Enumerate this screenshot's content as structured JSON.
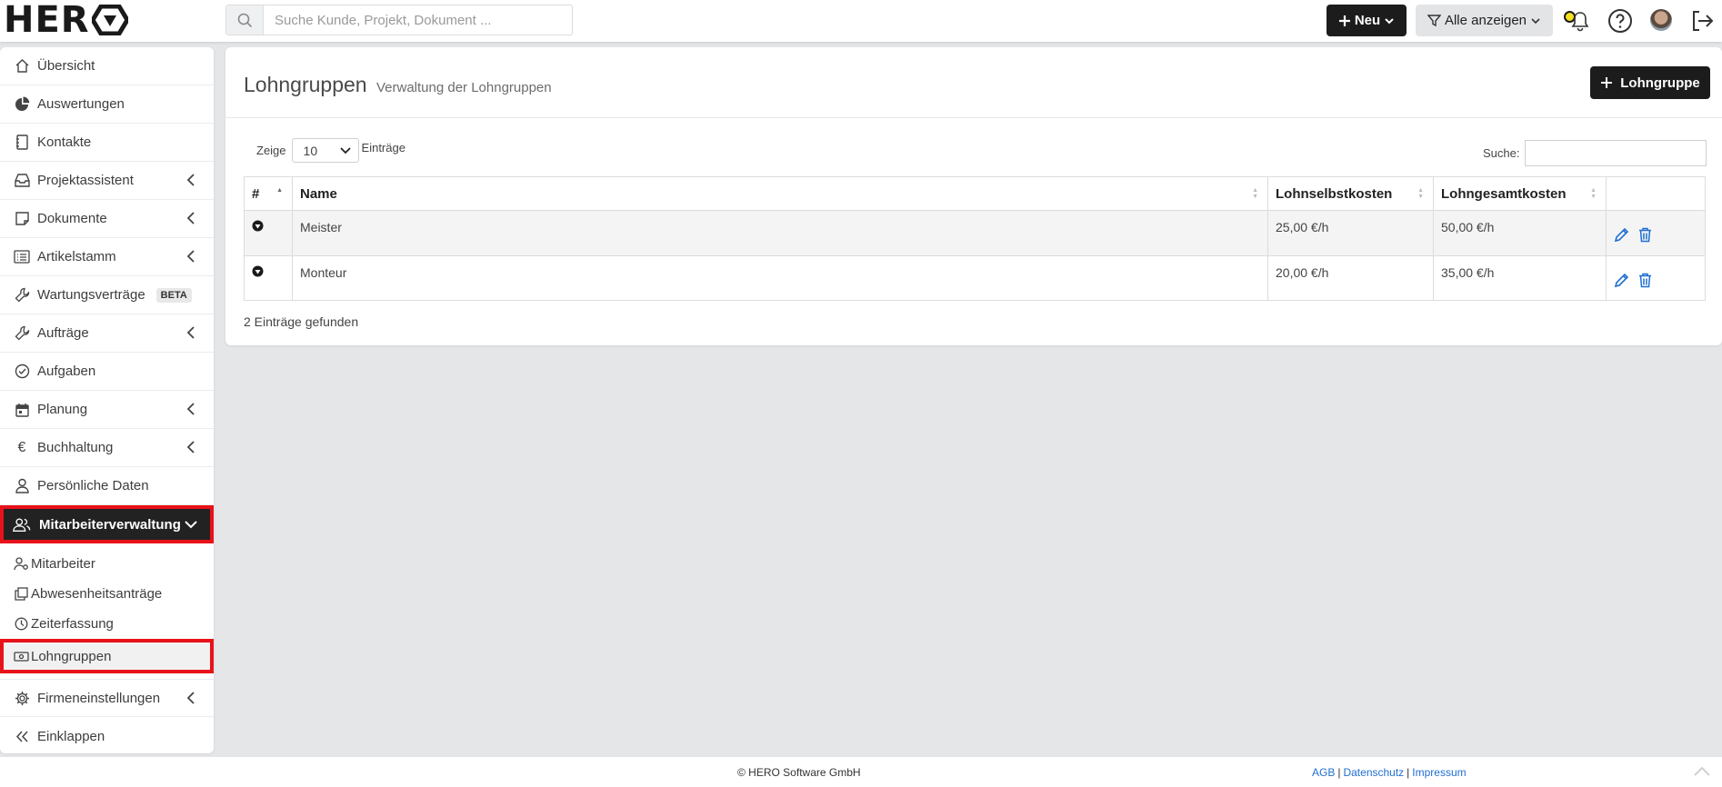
{
  "brand": {
    "logo_text": "HER"
  },
  "search": {
    "placeholder": "Suche Kunde, Projekt, Dokument ..."
  },
  "header": {
    "new_label": "Neu",
    "filter_label": "Alle anzeigen"
  },
  "sidebar": {
    "items": [
      {
        "label": "Übersicht"
      },
      {
        "label": "Auswertungen"
      },
      {
        "label": "Kontakte"
      },
      {
        "label": "Projektassistent"
      },
      {
        "label": "Dokumente"
      },
      {
        "label": "Artikelstamm"
      },
      {
        "label": "Wartungsverträge",
        "badge": "BETA"
      },
      {
        "label": "Aufträge"
      },
      {
        "label": "Aufgaben"
      },
      {
        "label": "Planung"
      },
      {
        "label": "Buchhaltung"
      },
      {
        "label": "Persönliche Daten"
      },
      {
        "label": "Mitarbeiterverwaltung"
      }
    ],
    "subitems": [
      {
        "label": "Mitarbeiter"
      },
      {
        "label": "Abwesenheitsanträge"
      },
      {
        "label": "Zeiterfassung"
      },
      {
        "label": "Lohngruppen"
      }
    ],
    "settings_label": "Firmeneinstellungen",
    "collapse_label": "Einklappen"
  },
  "main": {
    "title": "Lohngruppen",
    "subtitle": "Verwaltung der Lohngruppen",
    "add_label": "Lohngruppe",
    "length": {
      "prefix": "Zeige",
      "value": "10",
      "suffix": "Einträge"
    },
    "search_label": "Suche:",
    "columns": [
      "#",
      "Name",
      "Lohnselbstkosten",
      "Lohngesamtkosten"
    ],
    "rows": [
      {
        "name": "Meister",
        "self_cost": "25,00 €/h",
        "total_cost": "50,00 €/h"
      },
      {
        "name": "Monteur",
        "self_cost": "20,00 €/h",
        "total_cost": "35,00 €/h"
      }
    ],
    "found_text": "2 Einträge gefunden"
  },
  "footer": {
    "copyright": "© HERO Software GmbH",
    "links": [
      "AGB",
      "Datenschutz",
      "Impressum"
    ]
  },
  "colors": {
    "primary": "#1c1c1c",
    "highlight": "#e8121a",
    "link": "#1f6fd0",
    "action": "#1f6fd0"
  }
}
